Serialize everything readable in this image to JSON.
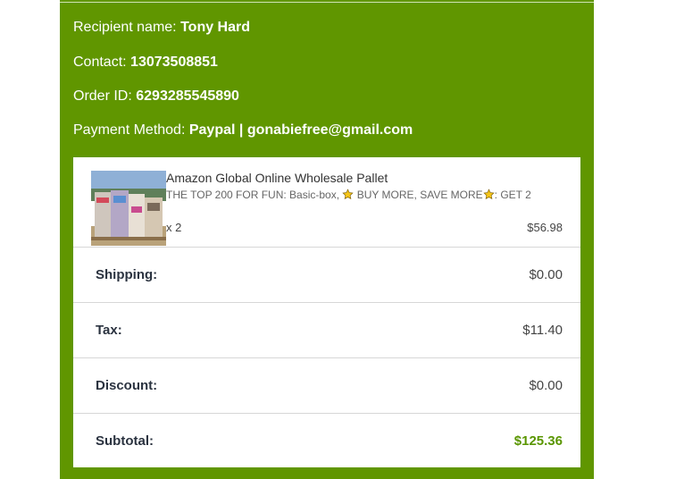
{
  "recipient": {
    "label": "Recipient name:",
    "value": "Tony Hard"
  },
  "contact": {
    "label": "Contact:",
    "value": "13073508851"
  },
  "order_id": {
    "label": "Order ID:",
    "value": "6293285545890"
  },
  "payment": {
    "label": "Payment Method:",
    "method": "Paypal",
    "separator": "|",
    "email": "gonabiefree@gmail.com"
  },
  "product": {
    "name": "Amazon Global Online Wholesale Pallet",
    "variant_a": "THE TOP 200 FOR FUN: Basic-box,",
    "variant_b": "BUY MORE, SAVE MORE",
    "variant_c": ": GET 2",
    "quantity": "x 2",
    "price": "$56.98",
    "image_icon": "product-pallet-photo"
  },
  "summary": {
    "shipping": {
      "label": "Shipping:",
      "value": "$0.00"
    },
    "tax": {
      "label": "Tax:",
      "value": "$11.40"
    },
    "discount": {
      "label": "Discount:",
      "value": "$0.00"
    },
    "subtotal": {
      "label": "Subtotal:",
      "value": "$125.36"
    }
  },
  "colors": {
    "panel": "#609600",
    "subtotal_value": "#5a9600",
    "star": "#f5c518"
  }
}
